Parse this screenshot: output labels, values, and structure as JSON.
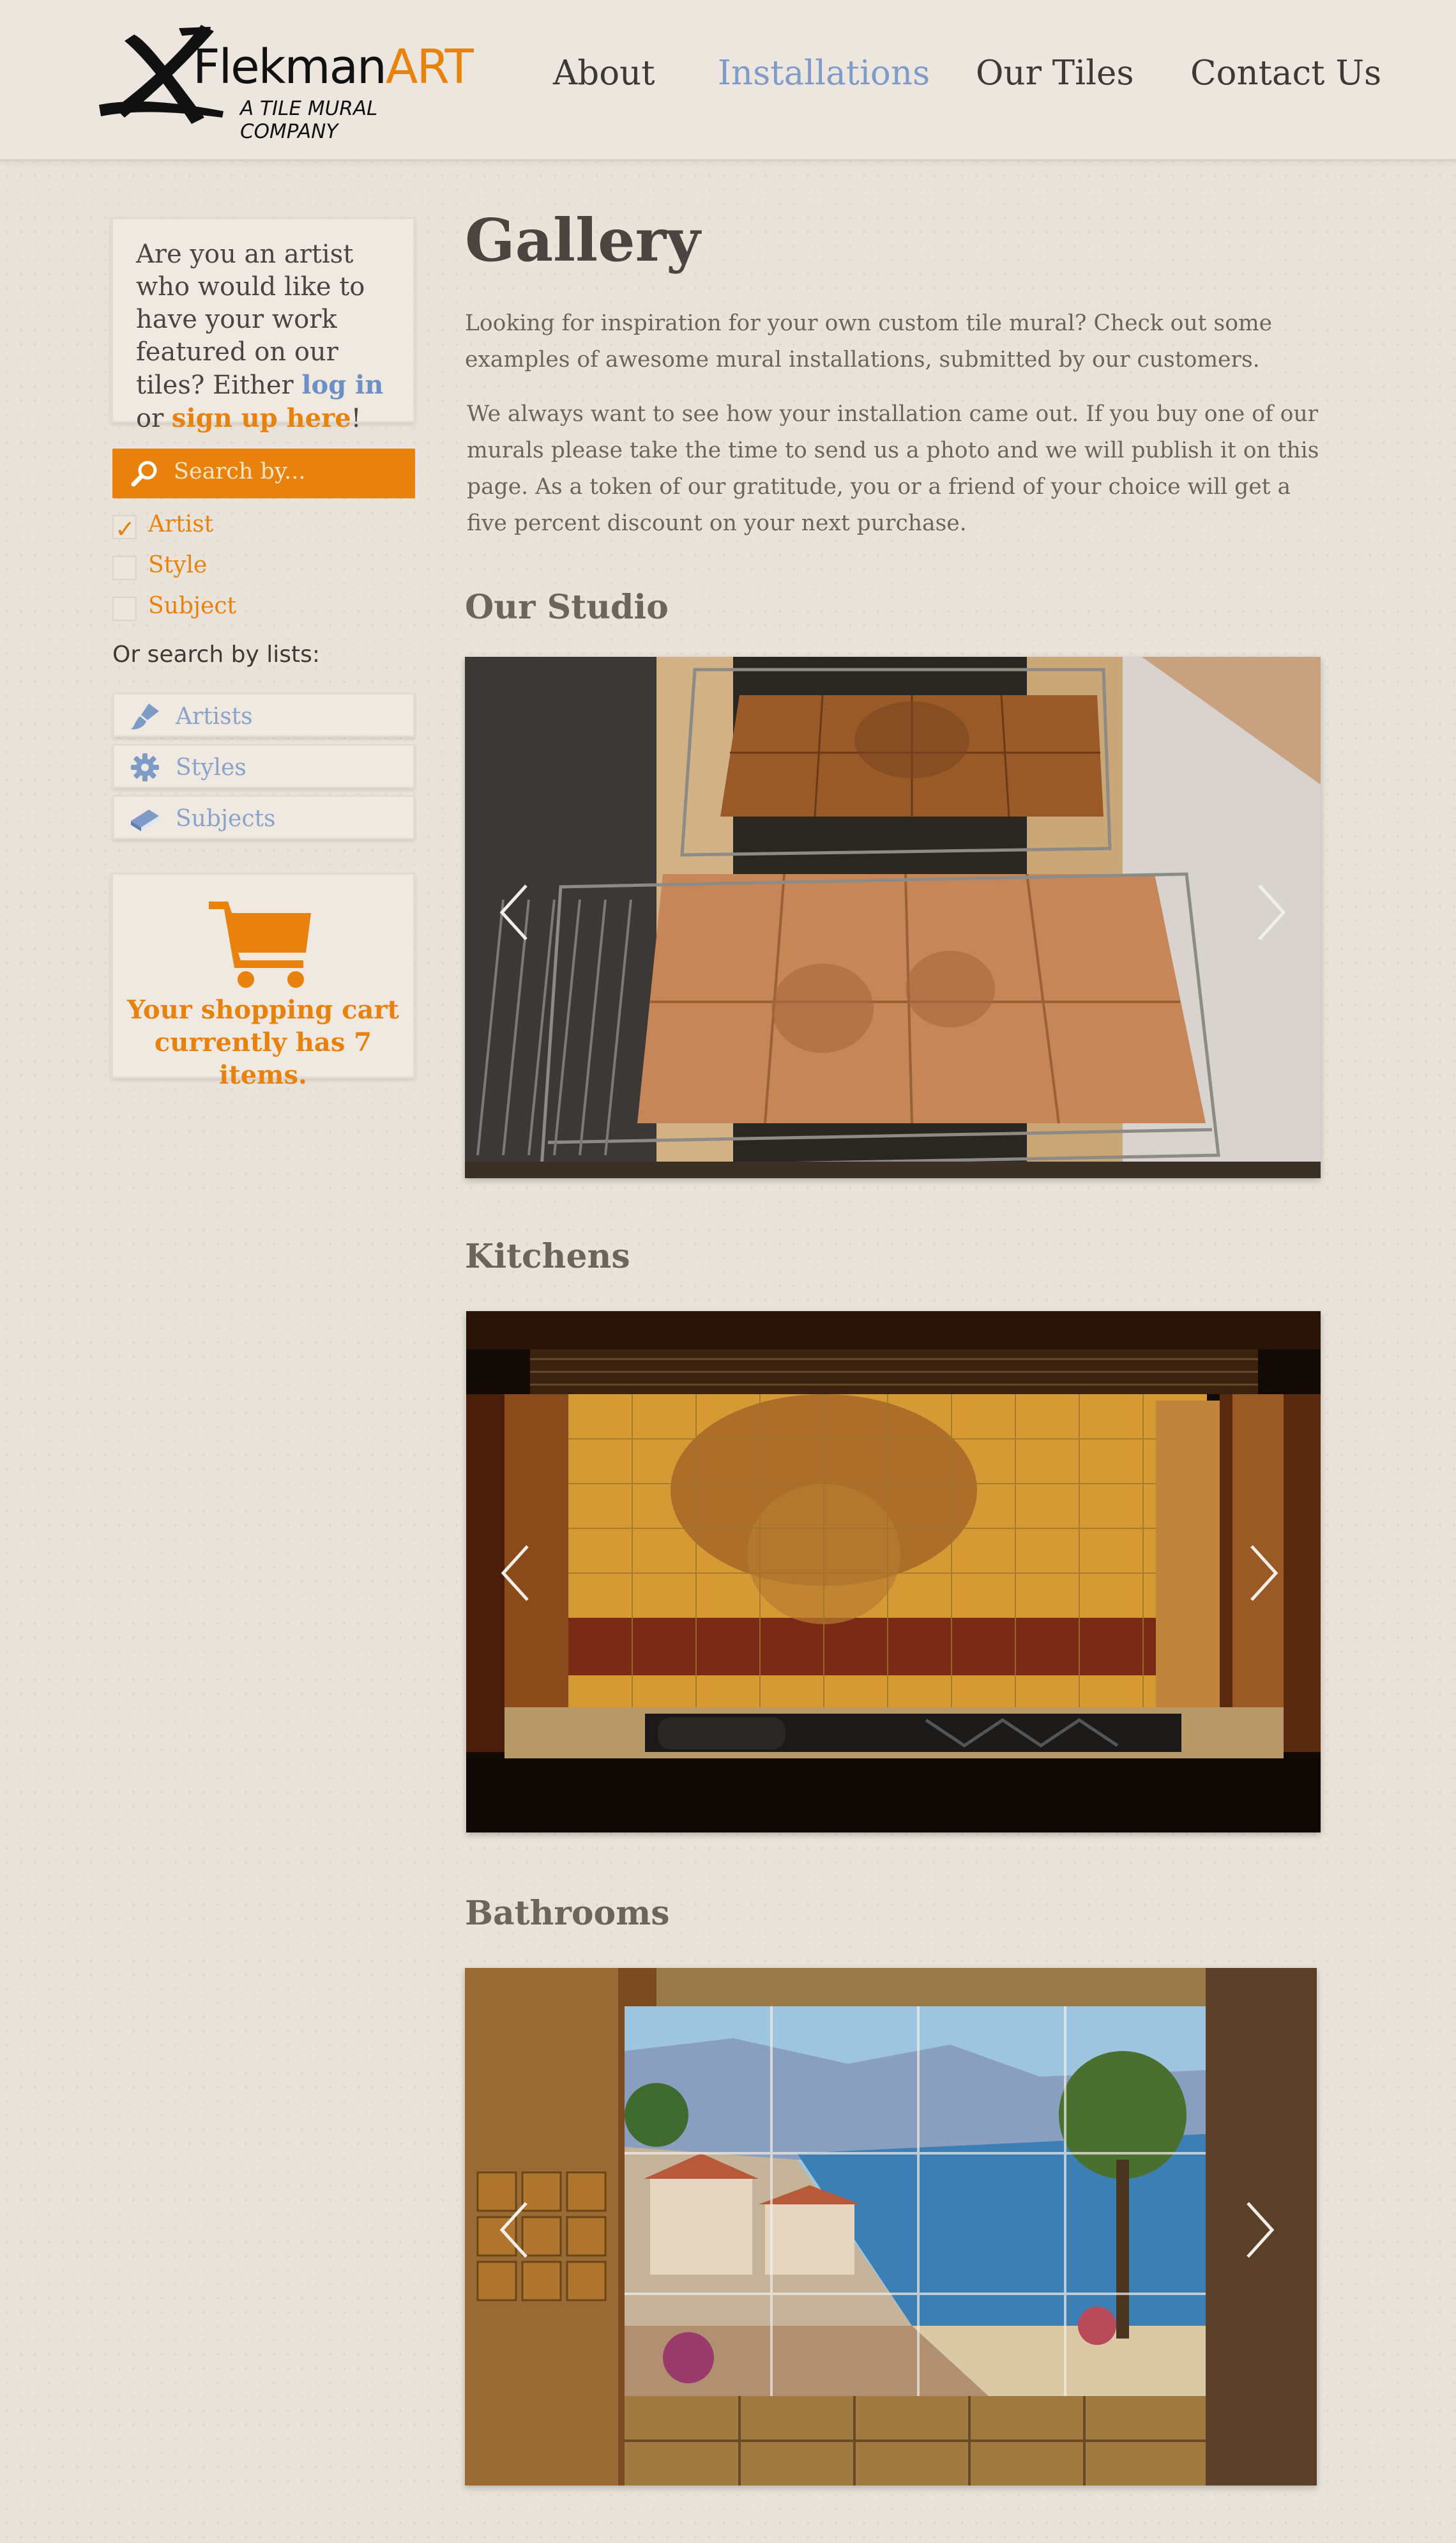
{
  "header": {
    "logo": {
      "name_main": "Flekman",
      "name_accent": "ART",
      "tagline": "A TILE MURAL COMPANY"
    },
    "nav": [
      {
        "label": "About",
        "active": false
      },
      {
        "label": "Installations",
        "active": true
      },
      {
        "label": "Our Tiles",
        "active": false
      },
      {
        "label": "Contact Us",
        "active": false
      }
    ]
  },
  "sidebar": {
    "artist_prompt": {
      "text": "Are you an artist who would like to have your work featured on our tiles? Either",
      "login_link": "log in",
      "connector": "or",
      "signup_link": "sign up here",
      "end": "!"
    },
    "search": {
      "placeholder": "Search by...",
      "icon": "magnifier-icon"
    },
    "filters": [
      {
        "label": "Artist",
        "checked": true
      },
      {
        "label": "Style",
        "checked": false
      },
      {
        "label": "Subject",
        "checked": false
      }
    ],
    "lists_label": "Or search by lists:",
    "lists": [
      {
        "label": "Artists",
        "icon": "paintbrush-icon"
      },
      {
        "label": "Styles",
        "icon": "gear-icon"
      },
      {
        "label": "Subjects",
        "icon": "book-icon"
      }
    ],
    "cart": {
      "text": "Your shopping cart currently has 7 items.",
      "icon": "shopping-cart-icon"
    }
  },
  "main": {
    "title": "Gallery",
    "intro_1": "Looking for inspiration for your own custom tile mural? Check out some examples of awesome mural installations, submitted by our customers.",
    "intro_2": "We always want to see how your installation came out. If you buy one of our murals please take the time to send us a photo and we will publish it on this page. As a token of our gratitude, you or a friend of your choice will get a five percent discount on your next purchase.",
    "sections": [
      {
        "title": "Our Studio"
      },
      {
        "title": "Kitchens"
      },
      {
        "title": "Bathrooms"
      }
    ]
  },
  "colors": {
    "accent": "#e8820c",
    "link_blue": "#6c8fc4",
    "nav_active": "#7d9cc7",
    "background": "#e9e3da"
  }
}
